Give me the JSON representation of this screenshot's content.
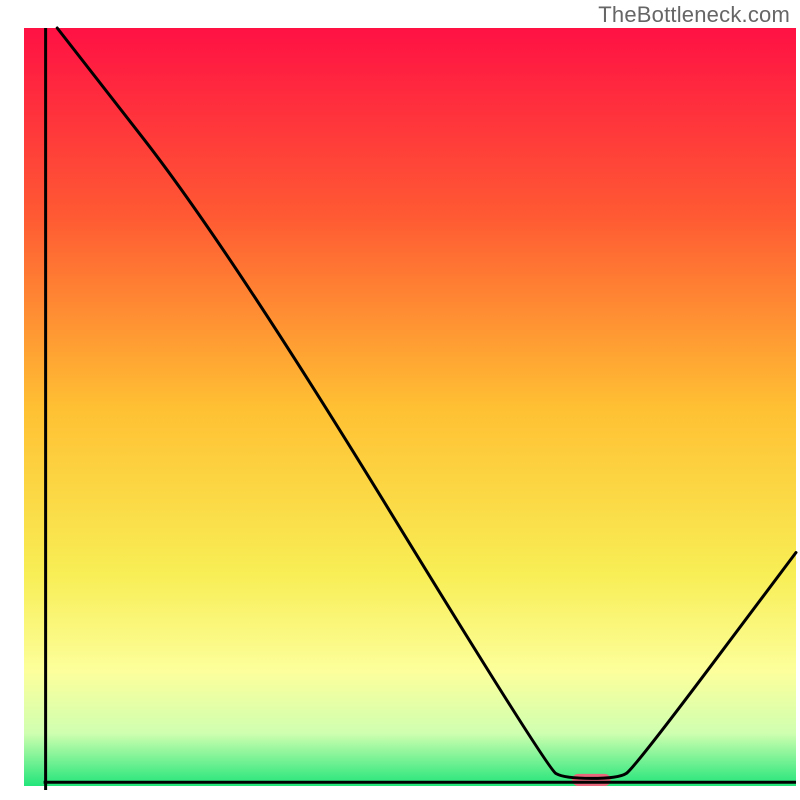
{
  "watermark": "TheBottleneck.com",
  "chart_data": {
    "type": "line",
    "title": "",
    "xlabel": "",
    "ylabel": "",
    "xlim": [
      0,
      100
    ],
    "ylim": [
      0,
      100
    ],
    "background_gradient": {
      "stops": [
        {
          "offset": 0,
          "color": "#ff1144"
        },
        {
          "offset": 25,
          "color": "#ff5a33"
        },
        {
          "offset": 50,
          "color": "#ffc033"
        },
        {
          "offset": 72,
          "color": "#f8ee55"
        },
        {
          "offset": 85,
          "color": "#fcff9c"
        },
        {
          "offset": 93,
          "color": "#d0ffb0"
        },
        {
          "offset": 100,
          "color": "#22e57a"
        }
      ]
    },
    "series": [
      {
        "name": "bottleneck-curve",
        "color": "#000000",
        "points": [
          {
            "x": 4.3,
            "y": 100.0
          },
          {
            "x": 26.5,
            "y": 71.0
          },
          {
            "x": 67.8,
            "y": 2.3
          },
          {
            "x": 70.0,
            "y": 1.0
          },
          {
            "x": 77.0,
            "y": 1.0
          },
          {
            "x": 79.0,
            "y": 2.3
          },
          {
            "x": 100.0,
            "y": 30.8
          }
        ]
      }
    ],
    "marker": {
      "x": 73.5,
      "y": 0.8,
      "width": 5.0,
      "height": 1.6,
      "color": "#e9677a"
    },
    "axes": {
      "color": "#000000",
      "left_x": 2.8,
      "bottom_y": 0.5,
      "thickness": 3
    }
  }
}
